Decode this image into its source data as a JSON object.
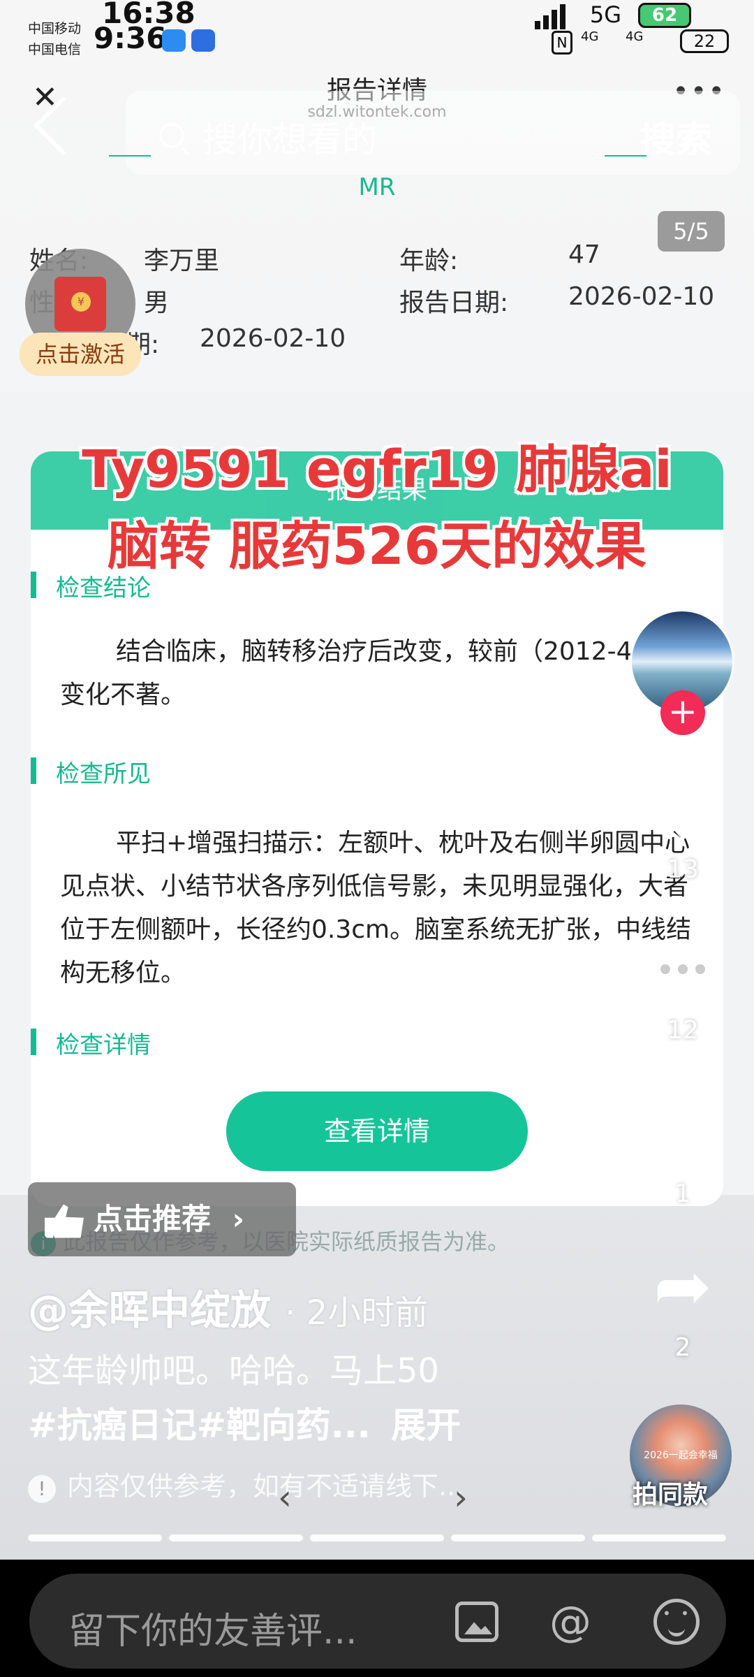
{
  "status_bar": {
    "carrier_1": "中国移动",
    "carrier_2": "中国电信",
    "time_primary": "16:38",
    "time_secondary": "9:36",
    "network": "5G",
    "net_4g_a": "4G",
    "net_4g_b": "4G",
    "battery_a": "62",
    "battery_b": "22"
  },
  "report": {
    "header_title": "报告详情",
    "url": "sdzl.witontek.com",
    "modality": "MR",
    "page_indicator": "5/5",
    "name_label": "姓名:",
    "name_value": "李万里",
    "age_label": "年龄:",
    "age_value": "47",
    "gender_label": "性",
    "gender_value": "男",
    "report_date_label": "报告日期:",
    "report_date_value": "2026-02-10",
    "exam_date_partial_label": "期:",
    "exam_date_value": "2026-02-10",
    "card_header": "报告结果",
    "section_conclusion": "检查结论",
    "conclusion_text": "结合临床，脑转移治疗后改变，较前（2012-4MR）变化不著。",
    "section_findings": "检查所见",
    "findings_text": "平扫+增强扫描示：左额叶、枕叶及右侧半卵圆中心见点状、小结节状各序列低信号影，未见明显强化，大者位于左侧额叶，长径约0.3cm。脑室系统无扩张，中线结构无移位。",
    "section_details": "检查详情",
    "view_details_button": "查看详情",
    "disclaimer": "此报告仅作参考，以医院实际纸质报告为准。"
  },
  "overlay": {
    "line1": "Ty9591 egfr19 肺腺ai",
    "line2": "脑转 服药526天的效果"
  },
  "search": {
    "placeholder": "搜你想看的",
    "button": "搜索"
  },
  "red_packet": {
    "label": "点击激活"
  },
  "side_rail": {
    "likes": "13",
    "comments": "12",
    "favorites": "1",
    "shares": "2",
    "music_label": "拍同款",
    "music_cover_text": "2026一起会幸福"
  },
  "video_info": {
    "recommend_label": "点击推荐",
    "author": "@余晖中绽放",
    "time_ago": "· 2小时前",
    "caption": "这年龄帅吧。哈哈。马上50",
    "tags": "#抗癌日记#靶向药...",
    "expand": "展开",
    "notice": "内容仅供参考，如有不适请线下..."
  },
  "comment_bar": {
    "placeholder": "留下你的友善评..."
  },
  "colors": {
    "accent_green": "#17b992",
    "overlay_red": "#e8393a",
    "follow_red": "#f22b57"
  }
}
